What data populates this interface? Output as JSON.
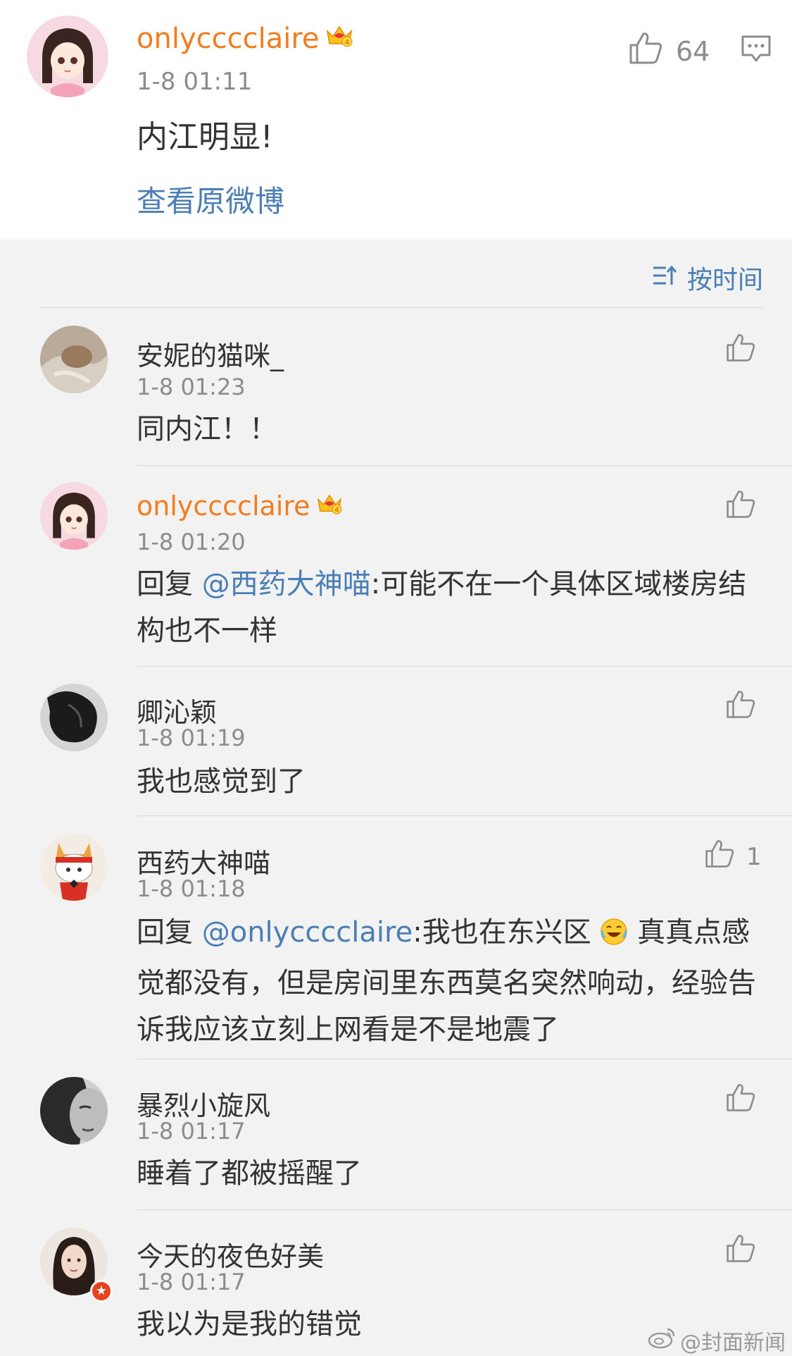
{
  "original": {
    "username": "onlycccclaire",
    "vip_level": "4",
    "time": "1-8 01:11",
    "text": "内江明显!",
    "like_count": "64",
    "view_original_label": "查看原微博"
  },
  "sort": {
    "label": "按时间"
  },
  "comments": [
    {
      "username": "安妮的猫咪_",
      "time": "1-8 01:23",
      "text": "同内江！！",
      "like_count": ""
    },
    {
      "username": "onlycccclaire",
      "vip_level": "4",
      "time": "1-8 01:20",
      "reply_prefix": "回复 ",
      "mention": "@西药大神喵",
      "text": ":可能不在一个具体区域楼房结构也不一样",
      "like_count": ""
    },
    {
      "username": "卿沁颖",
      "time": "1-8 01:19",
      "text": "我也感觉到了",
      "like_count": ""
    },
    {
      "username": "西药大神喵",
      "time": "1-8 01:18",
      "reply_prefix": "回复 ",
      "mention": "@onlycccclaire",
      "text_before_emoji": ":我也在东兴区 ",
      "emoji": "laughing-tears",
      "text_after_emoji": " 真真点感觉都没有，但是房间里东西莫名突然响动，经验告诉我应该立刻上网看是不是地震了",
      "like_count": "1"
    },
    {
      "username": "暴烈小旋风",
      "time": "1-8 01:17",
      "text": "睡着了都被摇醒了",
      "like_count": ""
    },
    {
      "username": "今天的夜色好美",
      "time": "1-8 01:17",
      "text": "我以为是我的错觉",
      "like_count": ""
    }
  ],
  "watermark": {
    "text": "@封面新闻"
  },
  "colors": {
    "vip_name": "#f37c1e",
    "link": "#4a7eb5",
    "meta": "#8c8c8c",
    "text": "#333333",
    "background": "#f2f2f2"
  },
  "icons": {
    "like": "thumbs-up-icon",
    "comment": "comment-bubble-icon",
    "sort": "sort-icon",
    "vip": "crown-icon"
  }
}
